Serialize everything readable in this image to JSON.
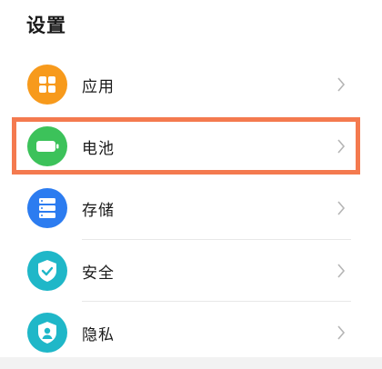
{
  "header": {
    "title": "设置"
  },
  "settings": {
    "items": [
      {
        "label": "应用",
        "icon": "apps-icon",
        "color": "#f79a1c"
      },
      {
        "label": "电池",
        "icon": "battery-icon",
        "color": "#3cc25a"
      },
      {
        "label": "存储",
        "icon": "storage-icon",
        "color": "#2c7cf0"
      },
      {
        "label": "安全",
        "icon": "shield-check-icon",
        "color": "#1fb7c8"
      },
      {
        "label": "隐私",
        "icon": "privacy-icon",
        "color": "#1fb7c8"
      }
    ]
  },
  "highlight": {
    "color": "#f47a4f",
    "target": "电池"
  }
}
